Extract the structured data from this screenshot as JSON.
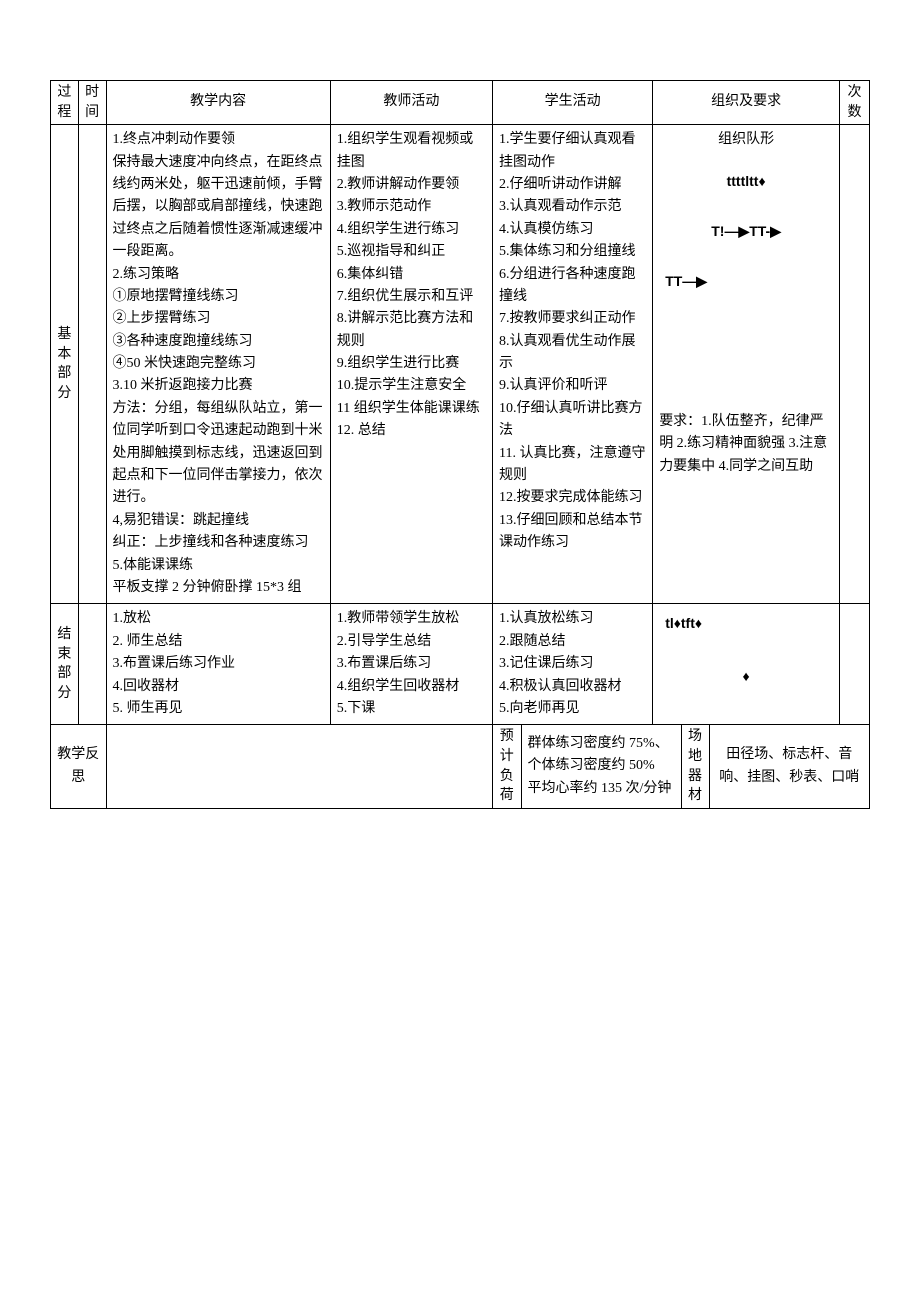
{
  "headers": {
    "process": "过程",
    "time": "时间",
    "content": "教学内容",
    "teacher": "教师活动",
    "student": "学生活动",
    "org": "组织及要求",
    "count": "次数"
  },
  "sections": {
    "basic": {
      "label_line1": "基本",
      "label_line2": "部分",
      "content": "1.终点冲刺动作要领\n保持最大速度冲向终点，在距终点线约两米处，躯干迅速前倾，手臂后摆，以胸部或肩部撞线，快速跑过终点之后随着惯性逐渐减速缓冲一段距离。\n2.练习策略\n①原地摆臂撞线练习\n②上步摆臂练习\n③各种速度跑撞线练习\n④50 米快速跑完整练习\n3.10 米折返跑接力比赛\n方法：分组，每组纵队站立，第一位同学听到口令迅速起动跑到十米处用脚触摸到标志线，迅速返回到起点和下一位同伴击掌接力，依次进行。\n4,易犯错误：跳起撞线\n纠正：上步撞线和各种速度练习\n5.体能课课练\n平板支撑 2 分钟俯卧撑 15*3 组",
      "teacher": "1.组织学生观看视频或挂图\n2.教师讲解动作要领\n3.教师示范动作\n4.组织学生进行练习\n5.巡视指导和纠正\n6.集体纠错\n7.组织优生展示和互评\n8.讲解示范比赛方法和规则\n9.组织学生进行比赛\n10.提示学生注意安全\n11 组织学生体能课课练\n12. 总结",
      "student": "1.学生要仔细认真观看挂图动作\n2.仔细听讲动作讲解\n3.认真观看动作示范\n4.认真模仿练习\n5.集体练习和分组撞线\n6.分组进行各种速度跑撞线\n7.按教师要求纠正动作\n8.认真观看优生动作展示\n9.认真评价和听评\n10.仔细认真听讲比赛方法\n11. 认真比赛，注意遵守规则\n12.按要求完成体能练习\n13.仔细回顾和总结本节课动作练习",
      "org_title": "组织队形",
      "org_sym1": "ttttltt♦",
      "org_sym2": "T!—▶TT-▶",
      "org_sym3": "TT—▶",
      "org_req": "要求：1.队伍整齐，纪律严明 2.练习精神面貌强 3.注意力要集中 4.同学之间互助"
    },
    "end": {
      "label_line1": "结束",
      "label_line2": "部分",
      "content": "1.放松\n2. 师生总结\n3.布置课后练习作业\n4.回收器材\n5. 师生再见",
      "teacher": "1.教师带领学生放松\n2.引导学生总结\n3.布置课后练习\n4.组织学生回收器材\n5.下课",
      "student": "1.认真放松练习\n2.跟随总结\n3.记住课后练习\n4.积极认真回收器材\n5.向老师再见",
      "org_sym": "tl♦tft♦",
      "org_sym_b": "♦"
    }
  },
  "footer": {
    "reflection_label": "教学反思",
    "load_label": "预计负荷",
    "load_value": "群体练习密度约 75%、个体练习密度约 50%\n平均心率约 135 次/分钟",
    "venue_label": "场地器材",
    "venue_value": "田径场、标志杆、音响、挂图、秒表、口哨"
  }
}
